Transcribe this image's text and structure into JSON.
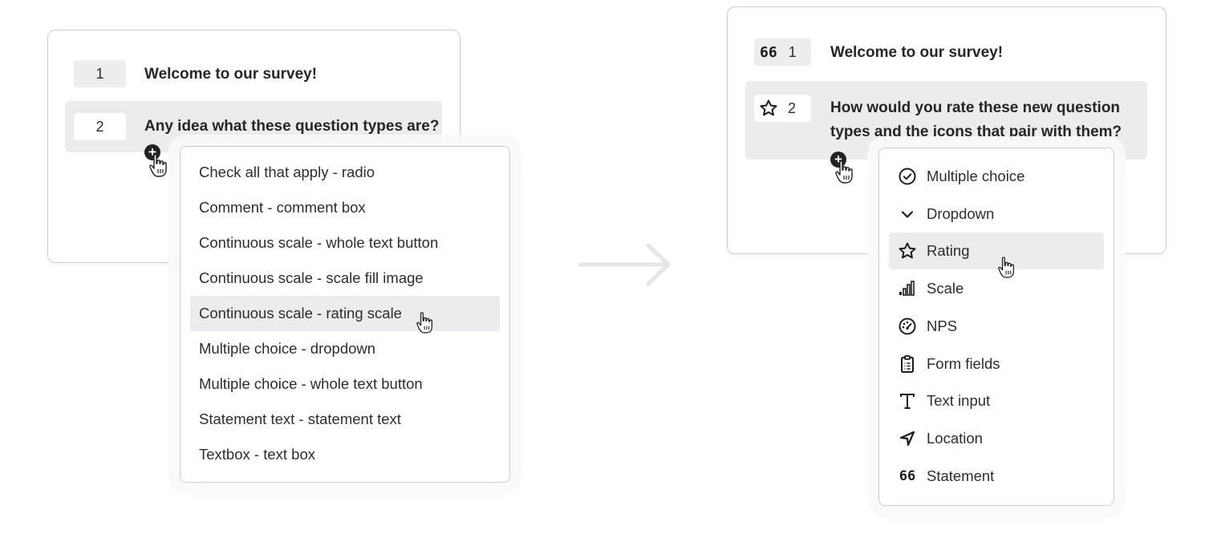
{
  "left_panel": {
    "questions": [
      {
        "number": "1",
        "text": "Welcome to our survey!"
      },
      {
        "number": "2",
        "text": "Any idea what these question types are?"
      }
    ],
    "menu_items": [
      "Check all that apply - radio",
      "Comment - comment box",
      "Continuous scale - whole text button",
      "Continuous scale - scale fill image",
      "Continuous scale - rating scale",
      "Multiple choice - dropdown",
      "Multiple choice - whole text button",
      "Statement text - statement text",
      "Textbox - text box"
    ],
    "highlighted_item": "Continuous scale - rating scale"
  },
  "right_panel": {
    "questions": [
      {
        "number": "1",
        "icon": "quote-icon",
        "icon_text": "66",
        "text": "Welcome to our survey!"
      },
      {
        "number": "2",
        "icon": "star-icon",
        "text_line1": "How would you rate these new question",
        "text_line2": "types and the icons that pair with them?"
      }
    ],
    "menu_items": [
      {
        "label": "Multiple choice",
        "icon": "check-circle-icon"
      },
      {
        "label": "Dropdown",
        "icon": "chevron-down-icon"
      },
      {
        "label": "Rating",
        "icon": "star-icon"
      },
      {
        "label": "Scale",
        "icon": "bars-icon"
      },
      {
        "label": "NPS",
        "icon": "gauge-icon"
      },
      {
        "label": "Form fields",
        "icon": "clipboard-icon"
      },
      {
        "label": "Text input",
        "icon": "text-icon"
      },
      {
        "label": "Location",
        "icon": "location-arrow-icon"
      },
      {
        "label": "Statement",
        "icon": "quote-icon",
        "icon_text": "66"
      }
    ],
    "highlighted_item": "Rating"
  },
  "add_button_symbol": "+",
  "colors": {
    "highlight": "#ebeced",
    "border": "#cfcfcf",
    "arrow": "#e6e6e6",
    "text": "#2b2b2b"
  }
}
